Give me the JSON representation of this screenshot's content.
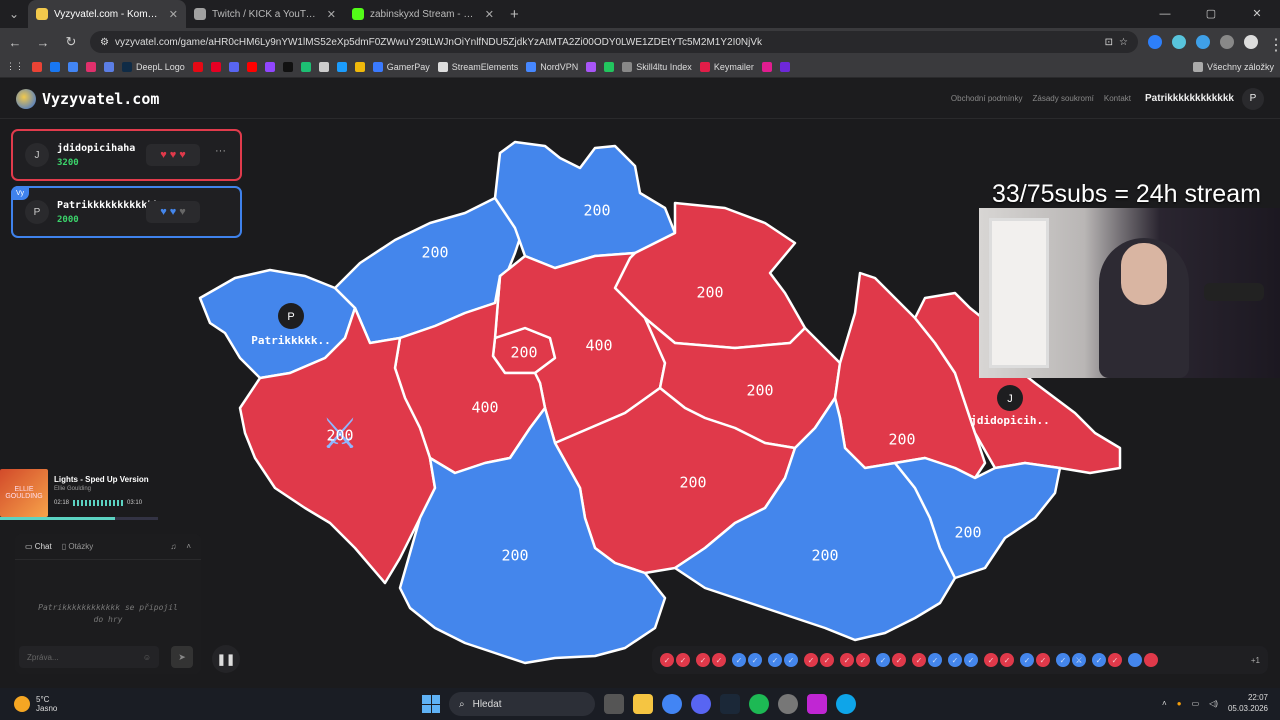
{
  "browser": {
    "tabs": [
      {
        "title": "Vyzyvatel.com - Komunitní vědo",
        "color": "#f2c94c",
        "active": true
      },
      {
        "title": "Twitch / KICK a YouTube | Vyzyv",
        "color": "#a1a1a1",
        "active": false
      },
      {
        "title": "zabinskyxd Stream - Watch Live",
        "color": "#53fc18",
        "active": false
      }
    ],
    "url": "vyzyvatel.com/game/aHR0cHM6Ly9nYW1lMS52eXp5dmF0ZWwuY29tLWJnOiYnlfNDU5ZjdkYzAtMTA2Zi00ODY0LWE1ZDEtYTc5M2M1Y2I0NjVk",
    "bookmarks": [
      "DeepL Logo",
      "GamerPay",
      "StreamElements",
      "NordVPN",
      "Skill4ltu Index",
      "Keymailer"
    ],
    "bookmarks_right": "Všechny záložky"
  },
  "site": {
    "logo": "Vyzyvatel.com",
    "links": [
      "Obchodní podmínky",
      "Zásady soukromí",
      "Kontakt"
    ],
    "user": "Patrikkkkkkkkkkkk",
    "user_initial": "P"
  },
  "players": [
    {
      "initial": "J",
      "name": "jdidopicihaha",
      "score": "3200",
      "color": "red",
      "hearts": [
        "full",
        "full",
        "full"
      ]
    },
    {
      "initial": "P",
      "name": "Patrikkkkkkkkkkkk",
      "score": "2000",
      "color": "blue",
      "hearts": [
        "full",
        "full",
        "empty"
      ],
      "badge": "Vy"
    }
  ],
  "colors": {
    "red": "#e0394a",
    "blue": "#4486ec",
    "empty": "#666666"
  },
  "map": {
    "regions": [
      {
        "id": "karlovarsky",
        "owner": "blue",
        "value": "",
        "label": "Patrikkkkk..",
        "avatar": "P"
      },
      {
        "id": "ustecky",
        "owner": "blue",
        "value": "200"
      },
      {
        "id": "liberecky",
        "owner": "blue",
        "value": "200"
      },
      {
        "id": "kralovehradecky",
        "owner": "red",
        "value": "200"
      },
      {
        "id": "praha",
        "owner": "red",
        "value": "200"
      },
      {
        "id": "stredocesky",
        "owner": "red",
        "value": "400"
      },
      {
        "id": "stredocesky-west",
        "owner": "red",
        "value": "400"
      },
      {
        "id": "plzensky",
        "owner": "red",
        "value": "200",
        "battle": true
      },
      {
        "id": "pardubicky",
        "owner": "red",
        "value": "200"
      },
      {
        "id": "olomoucky",
        "owner": "red",
        "value": "200"
      },
      {
        "id": "moravskoslezsky",
        "owner": "red",
        "value": "",
        "label": "jdidopicih..",
        "avatar": "J"
      },
      {
        "id": "vysocina",
        "owner": "red",
        "value": "200"
      },
      {
        "id": "jihocesky",
        "owner": "blue",
        "value": "200"
      },
      {
        "id": "jihomoravsky",
        "owner": "blue",
        "value": "200"
      },
      {
        "id": "zlinsky",
        "owner": "blue",
        "value": "200"
      }
    ]
  },
  "overlay": {
    "subs": "33/75subs = 24h stream"
  },
  "music": {
    "title": "Lights - Sped Up Version",
    "artist": "Ellie Goulding",
    "elapsed": "02:18",
    "total": "03:10",
    "progress": 0.73,
    "cover_text": "ELLIE GOULDING"
  },
  "chat": {
    "tab_chat": "Chat",
    "tab_questions": "Otázky",
    "message": "Patrikkkkkkkkkkkk se připojil do hry",
    "placeholder": "Zpráva..."
  },
  "history": {
    "pairs": [
      [
        "red",
        "red"
      ],
      [
        "red",
        "red"
      ],
      [
        "blue",
        "blue"
      ],
      [
        "blue",
        "blue"
      ],
      [
        "red",
        "red"
      ],
      [
        "red",
        "red"
      ],
      [
        "blue",
        "red"
      ],
      [
        "red",
        "blue"
      ],
      [
        "blue",
        "blue"
      ],
      [
        "red",
        "red"
      ],
      [
        "blue",
        "red"
      ],
      [
        "blue",
        "battle"
      ],
      [
        "blue",
        "red"
      ]
    ],
    "more": "+1"
  },
  "taskbar": {
    "temp": "5°C",
    "weather": "Jasno",
    "search": "Hledat",
    "time": "22:07",
    "date": "05.03.2026"
  }
}
